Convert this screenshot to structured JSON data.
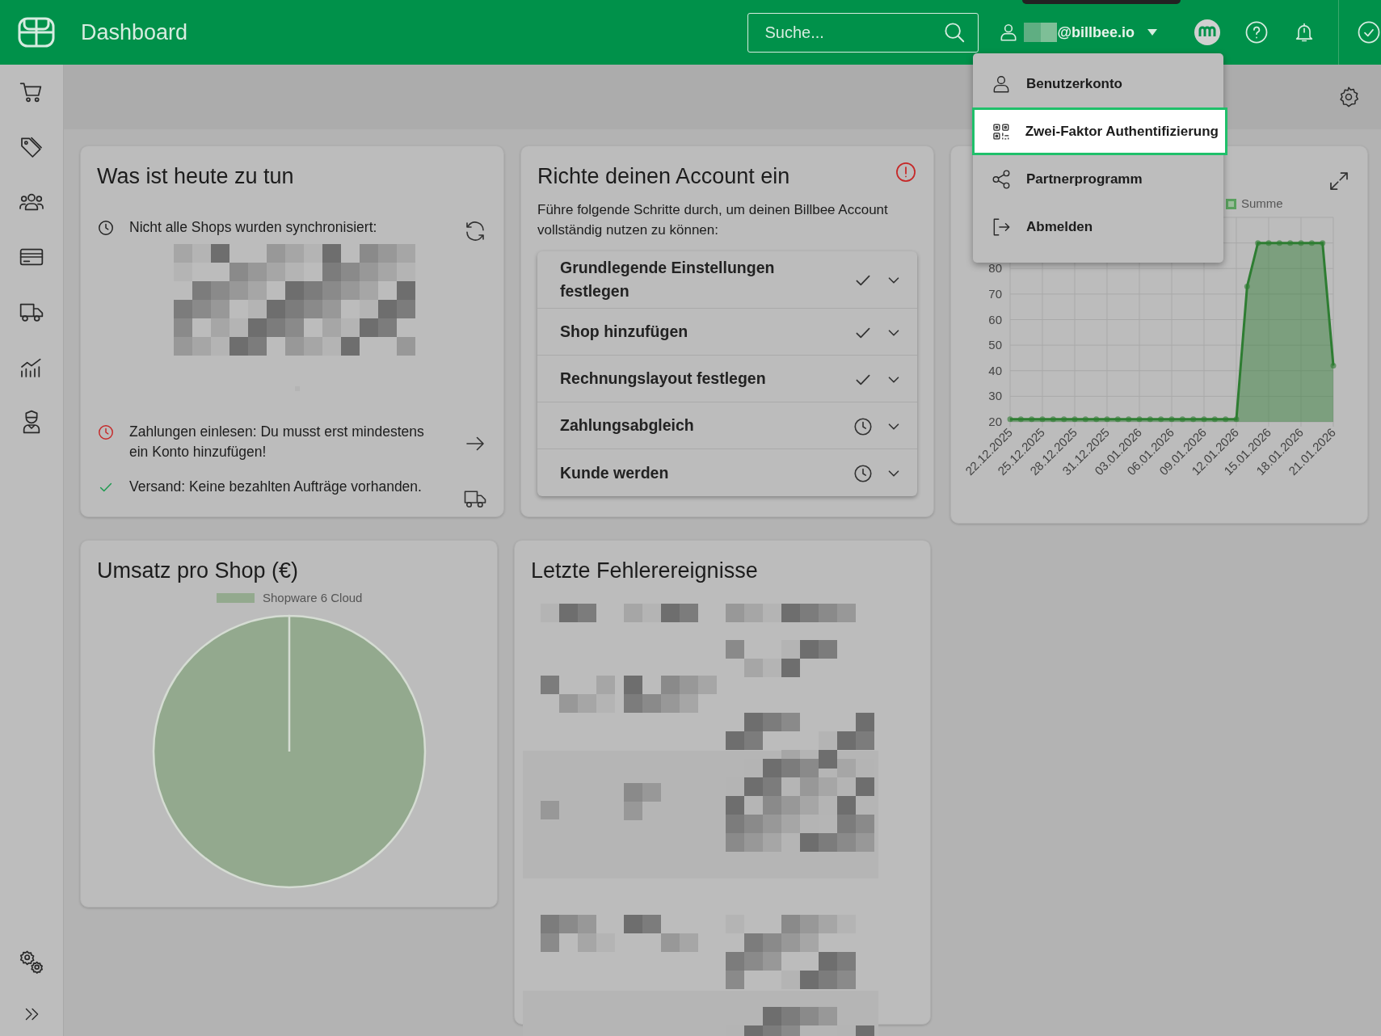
{
  "topbar": {
    "title": "Dashboard",
    "search": {
      "placeholder": "Suche..."
    },
    "user_email": "@billbee.io"
  },
  "user_menu": {
    "items": [
      {
        "label": "Benutzerkonto",
        "selected": false
      },
      {
        "label": "Zwei-Faktor Authentifizierung",
        "selected": true
      },
      {
        "label": "Partnerprogramm",
        "selected": false
      },
      {
        "label": "Abmelden",
        "selected": false
      }
    ]
  },
  "todo_card": {
    "title": "Was ist heute zu tun",
    "items": [
      {
        "kind": "pending",
        "text": "Nicht alle Shops wurden synchronisiert:"
      },
      {
        "kind": "warning",
        "text": "Zahlungen einlesen: Du musst erst mindestens ein Konto hinzufügen!"
      },
      {
        "kind": "done",
        "text": "Versand: Keine bezahlten Aufträge vorhanden."
      }
    ]
  },
  "setup_card": {
    "title": "Richte deinen Account ein",
    "text": "Führe folgende Schritte durch, um deinen Billbee Account vollständig nutzen zu können:",
    "steps": [
      {
        "label": "Grundlegende Einstellungen festlegen",
        "done": true
      },
      {
        "label": "Shop hinzufügen",
        "done": true
      },
      {
        "label": "Rechnungslayout festlegen",
        "done": true
      },
      {
        "label": "Zahlungsabgleich",
        "done": false
      },
      {
        "label": "Kunde werden",
        "done": false
      }
    ]
  },
  "sales_card": {
    "chart_data": {
      "type": "area",
      "grid": true,
      "categories": [
        "22.12.2025",
        null,
        null,
        "25.12.2025",
        null,
        null,
        "28.12.2025",
        null,
        null,
        "31.12.2025",
        null,
        null,
        "03.01.2026",
        null,
        null,
        "06.01.2026",
        null,
        null,
        "09.01.2026",
        null,
        null,
        "12.01.2026",
        null,
        null,
        "15.01.2026",
        null,
        null,
        "18.01.2026",
        null,
        null,
        "21.01.2026"
      ],
      "ylim": [
        20,
        100
      ],
      "yticks": [
        20,
        30,
        40,
        50,
        60,
        70,
        80
      ],
      "series": [
        {
          "name": "Summe",
          "color": "#2e7d32",
          "values": [
            21,
            21,
            21,
            21,
            21,
            21,
            21,
            21,
            21,
            21,
            21,
            21,
            21,
            21,
            21,
            21,
            21,
            21,
            21,
            21,
            21,
            21,
            73,
            90,
            90,
            90,
            90,
            90,
            90,
            90,
            42
          ]
        }
      ]
    }
  },
  "revenue_card": {
    "title": "Umsatz pro Shop (€)",
    "chart_data": {
      "type": "pie",
      "categories": [
        "Shopware 6 Cloud"
      ],
      "values": [
        100
      ]
    }
  },
  "errors_card": {
    "title": "Letzte Fehlerereignisse"
  }
}
